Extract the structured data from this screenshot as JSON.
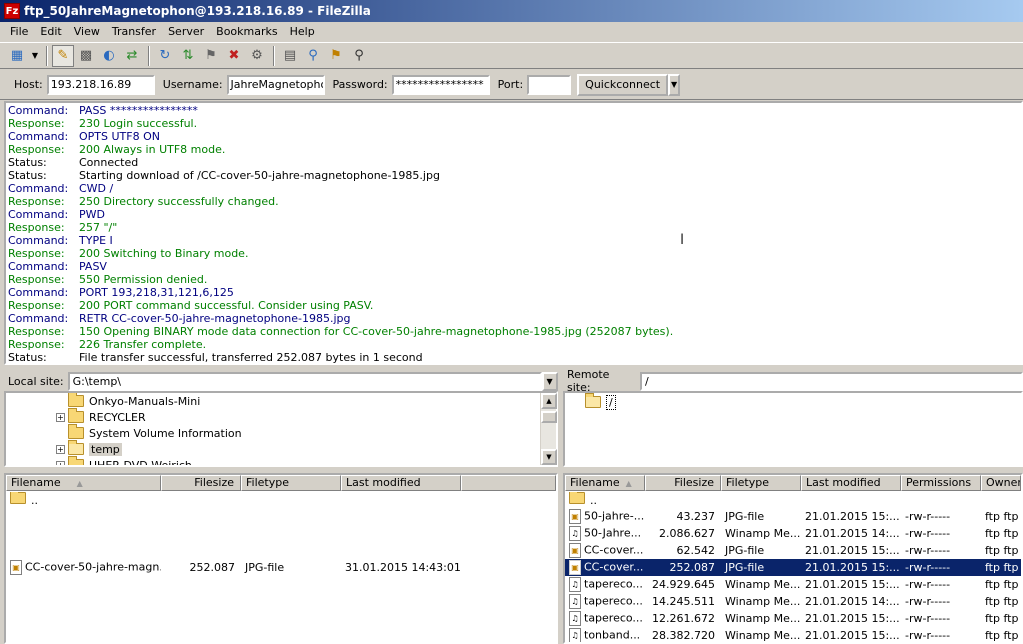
{
  "window": {
    "title": "ftp_50JahreMagnetophon@193.218.16.89 - FileZilla",
    "app_icon": "Fz"
  },
  "menu": [
    "File",
    "Edit",
    "View",
    "Transfer",
    "Server",
    "Bookmarks",
    "Help"
  ],
  "toolbar_icons": [
    "site-manager-icon",
    "dropdown-arrow-icon",
    "toggle-message-log-icon",
    "toggle-local-tree-icon",
    "toggle-remote-tree-icon",
    "toggle-transfer-queue-icon",
    "refresh-icon",
    "process-queue-icon",
    "cancel-icon",
    "disconnect-icon",
    "reconnect-icon",
    "directory-listing-filters-icon",
    "compare-directories-icon",
    "sync-browsing-icon",
    "search-icon"
  ],
  "quickconnect": {
    "host_label": "Host:",
    "host_value": "193.218.16.89",
    "username_label": "Username:",
    "username_value": "JahreMagnetophon",
    "password_label": "Password:",
    "password_value": "****************",
    "port_label": "Port:",
    "port_value": "",
    "button": "Quickconnect"
  },
  "log": [
    {
      "type": "Command:",
      "msg": "PASS ****************",
      "kind": "command"
    },
    {
      "type": "Response:",
      "msg": "230 Login successful.",
      "kind": "response"
    },
    {
      "type": "Command:",
      "msg": "OPTS UTF8 ON",
      "kind": "command"
    },
    {
      "type": "Response:",
      "msg": "200 Always in UTF8 mode.",
      "kind": "response"
    },
    {
      "type": "Status:",
      "msg": "Connected",
      "kind": "status"
    },
    {
      "type": "Status:",
      "msg": "Starting download of /CC-cover-50-jahre-magnetophone-1985.jpg",
      "kind": "status"
    },
    {
      "type": "Command:",
      "msg": "CWD /",
      "kind": "command"
    },
    {
      "type": "Response:",
      "msg": "250 Directory successfully changed.",
      "kind": "response"
    },
    {
      "type": "Command:",
      "msg": "PWD",
      "kind": "command"
    },
    {
      "type": "Response:",
      "msg": "257 \"/\"",
      "kind": "response"
    },
    {
      "type": "Command:",
      "msg": "TYPE I",
      "kind": "command"
    },
    {
      "type": "Response:",
      "msg": "200 Switching to Binary mode.",
      "kind": "response"
    },
    {
      "type": "Command:",
      "msg": "PASV",
      "kind": "command"
    },
    {
      "type": "Response:",
      "msg": "550 Permission denied.",
      "kind": "response"
    },
    {
      "type": "Command:",
      "msg": "PORT 193,218,31,121,6,125",
      "kind": "command"
    },
    {
      "type": "Response:",
      "msg": "200 PORT command successful. Consider using PASV.",
      "kind": "response"
    },
    {
      "type": "Command:",
      "msg": "RETR CC-cover-50-jahre-magnetophone-1985.jpg",
      "kind": "command"
    },
    {
      "type": "Response:",
      "msg": "150 Opening BINARY mode data connection for CC-cover-50-jahre-magnetophone-1985.jpg (252087 bytes).",
      "kind": "response"
    },
    {
      "type": "Response:",
      "msg": "226 Transfer complete.",
      "kind": "response"
    },
    {
      "type": "Status:",
      "msg": "File transfer successful, transferred 252.087 bytes in 1 second",
      "kind": "status"
    }
  ],
  "colors": {
    "command": "#000080",
    "response": "#008000",
    "status": "#000000",
    "selection": "#0a246a"
  },
  "local_site": {
    "label": "Local site:",
    "path": "G:\\temp\\",
    "tree": [
      {
        "name": "Onkyo-Manuals-Mini",
        "expander": ""
      },
      {
        "name": "RECYCLER",
        "expander": "+"
      },
      {
        "name": "System Volume Information",
        "expander": ""
      },
      {
        "name": "temp",
        "expander": "+",
        "selected": true
      },
      {
        "name": "UHER-DVD-Weirich",
        "expander": "+"
      }
    ],
    "columns": [
      "Filename",
      "Filesize",
      "Filetype",
      "Last modified"
    ],
    "files": [
      {
        "name": "..",
        "size": "",
        "type": "",
        "modified": "",
        "icon": "folder"
      },
      {
        "name": "CC-cover-50-jahre-magn...",
        "size": "252.087",
        "type": "JPG-file",
        "modified": "31.01.2015 14:43:01",
        "icon": "jpg"
      }
    ]
  },
  "remote_site": {
    "label": "Remote site:",
    "path": "/",
    "tree": [
      {
        "name": "/"
      }
    ],
    "columns": [
      "Filename",
      "Filesize",
      "Filetype",
      "Last modified",
      "Permissions",
      "Owner/G"
    ],
    "files": [
      {
        "name": "..",
        "size": "",
        "type": "",
        "modified": "",
        "perm": "",
        "owner": "",
        "icon": "folder"
      },
      {
        "name": "50-jahre-...",
        "size": "43.237",
        "type": "JPG-file",
        "modified": "21.01.2015 15:...",
        "perm": "-rw-r-----",
        "owner": "ftp ftp",
        "icon": "jpg"
      },
      {
        "name": "50-Jahre...",
        "size": "2.086.627",
        "type": "Winamp Me...",
        "modified": "21.01.2015 14:...",
        "perm": "-rw-r-----",
        "owner": "ftp ftp",
        "icon": "audio"
      },
      {
        "name": "CC-cover...",
        "size": "62.542",
        "type": "JPG-file",
        "modified": "21.01.2015 15:...",
        "perm": "-rw-r-----",
        "owner": "ftp ftp",
        "icon": "jpg"
      },
      {
        "name": "CC-cover...",
        "size": "252.087",
        "type": "JPG-file",
        "modified": "21.01.2015 15:...",
        "perm": "-rw-r-----",
        "owner": "ftp ftp",
        "icon": "jpg",
        "selected": true
      },
      {
        "name": "tapereco...",
        "size": "24.929.645",
        "type": "Winamp Me...",
        "modified": "21.01.2015 15:...",
        "perm": "-rw-r-----",
        "owner": "ftp ftp",
        "icon": "audio"
      },
      {
        "name": "tapereco...",
        "size": "14.245.511",
        "type": "Winamp Me...",
        "modified": "21.01.2015 14:...",
        "perm": "-rw-r-----",
        "owner": "ftp ftp",
        "icon": "audio"
      },
      {
        "name": "tapereco...",
        "size": "12.261.672",
        "type": "Winamp Me...",
        "modified": "21.01.2015 15:...",
        "perm": "-rw-r-----",
        "owner": "ftp ftp",
        "icon": "audio"
      },
      {
        "name": "tonband...",
        "size": "28.382.720",
        "type": "Winamp Me...",
        "modified": "21.01.2015 15:...",
        "perm": "-rw-r-----",
        "owner": "ftp ftp",
        "icon": "audio"
      }
    ]
  }
}
